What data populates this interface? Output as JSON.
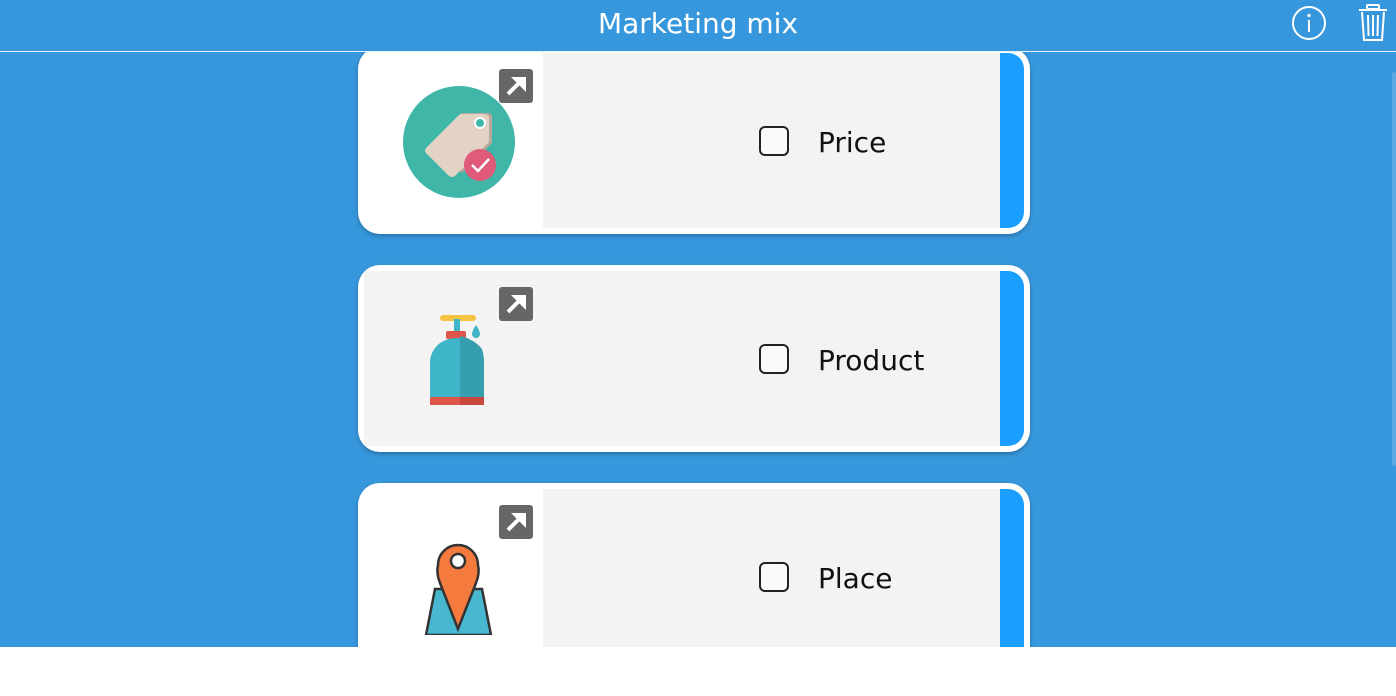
{
  "header": {
    "title": "Marketing mix",
    "info_icon": "info-icon",
    "trash_icon": "trash-icon"
  },
  "colors": {
    "header_bg": "#3797dc",
    "content_bg": "#3797dc",
    "accent_stripe": "#1a9eff",
    "card_panel": "#f3f3f3"
  },
  "cards": [
    {
      "label": "Price",
      "icon": "price-tag-icon",
      "checked": false
    },
    {
      "label": "Product",
      "icon": "soap-bottle-icon",
      "checked": false
    },
    {
      "label": "Place",
      "icon": "map-pin-icon",
      "checked": false
    }
  ]
}
